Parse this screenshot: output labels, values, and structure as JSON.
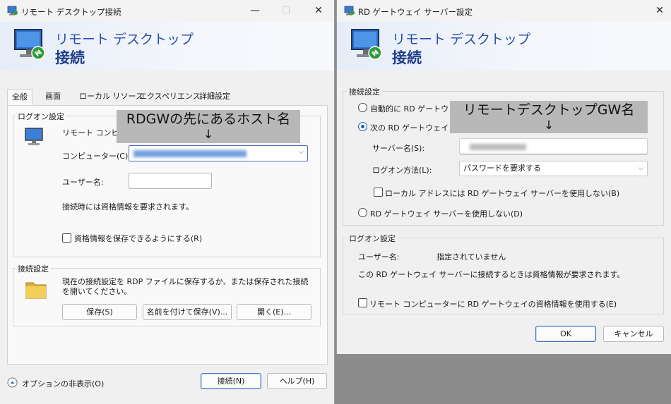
{
  "left_window": {
    "title": "リモート デスクトップ接続",
    "banner_line1": "リモート デスクトップ",
    "banner_line2": "接続",
    "tabs": [
      "全般",
      "画面",
      "ローカル リソース",
      "エクスペリエンス",
      "詳細設定"
    ],
    "logon_group_title": "ログオン設定",
    "logon_hint": "リモート コンピュー",
    "computer_label": "コンピューター(C):",
    "username_label": "ユーザー名:",
    "username_value": "",
    "credential_prompt": "接続時には資格情報を要求されます。",
    "save_credentials_label": "資格情報を保存できるようにする(R)",
    "connection_group_title": "接続設定",
    "connection_desc": "現在の接続設定を RDP ファイルに保存するか、または保存された接続を開いてください。",
    "save_button": "保存(S)",
    "save_as_button": "名前を付けて保存(V)...",
    "open_button": "開く(E)...",
    "options_toggle": "オプションの非表示(O)",
    "connect_button": "接続(N)",
    "help_button": "ヘルプ(H)",
    "annotation": "RDGWの先にあるホスト名",
    "annotation_arrow": "↓"
  },
  "right_window": {
    "title": "RD ゲートウェイ サーバー設定",
    "banner_line1": "リモート デスクトップ",
    "banner_line2": "接続",
    "connection_group_title": "接続設定",
    "auto_detect_label": "自動的に RD ゲートウェイ",
    "use_next_label": "次の RD ゲートウェイ サー",
    "server_name_label": "サーバー名(S):",
    "logon_method_label": "ログオン方法(L):",
    "logon_method_value": "パスワードを要求する",
    "bypass_local_label": "ローカル アドレスには RD ゲートウェイ サーバーを使用しない(B)",
    "no_gateway_label": "RD ゲートウェイ サーバーを使用しない(D)",
    "logon_group_title": "ログオン設定",
    "username_label": "ユーザー名:",
    "username_value": "指定されていません",
    "credential_note": "この RD ゲートウェイ サーバーに接続するときは資格情報が要求されます。",
    "use_credentials_label": "リモート コンピューターに RD ゲートウェイの資格情報を使用する(E)",
    "ok_button": "OK",
    "cancel_button": "キャンセル",
    "annotation": "リモートデスクトップGW名",
    "annotation_arrow": "↓"
  },
  "colors": {
    "accent": "#1b5fb8",
    "banner_text": "#2850a8",
    "annotation_bg": "#b8b8b8"
  }
}
